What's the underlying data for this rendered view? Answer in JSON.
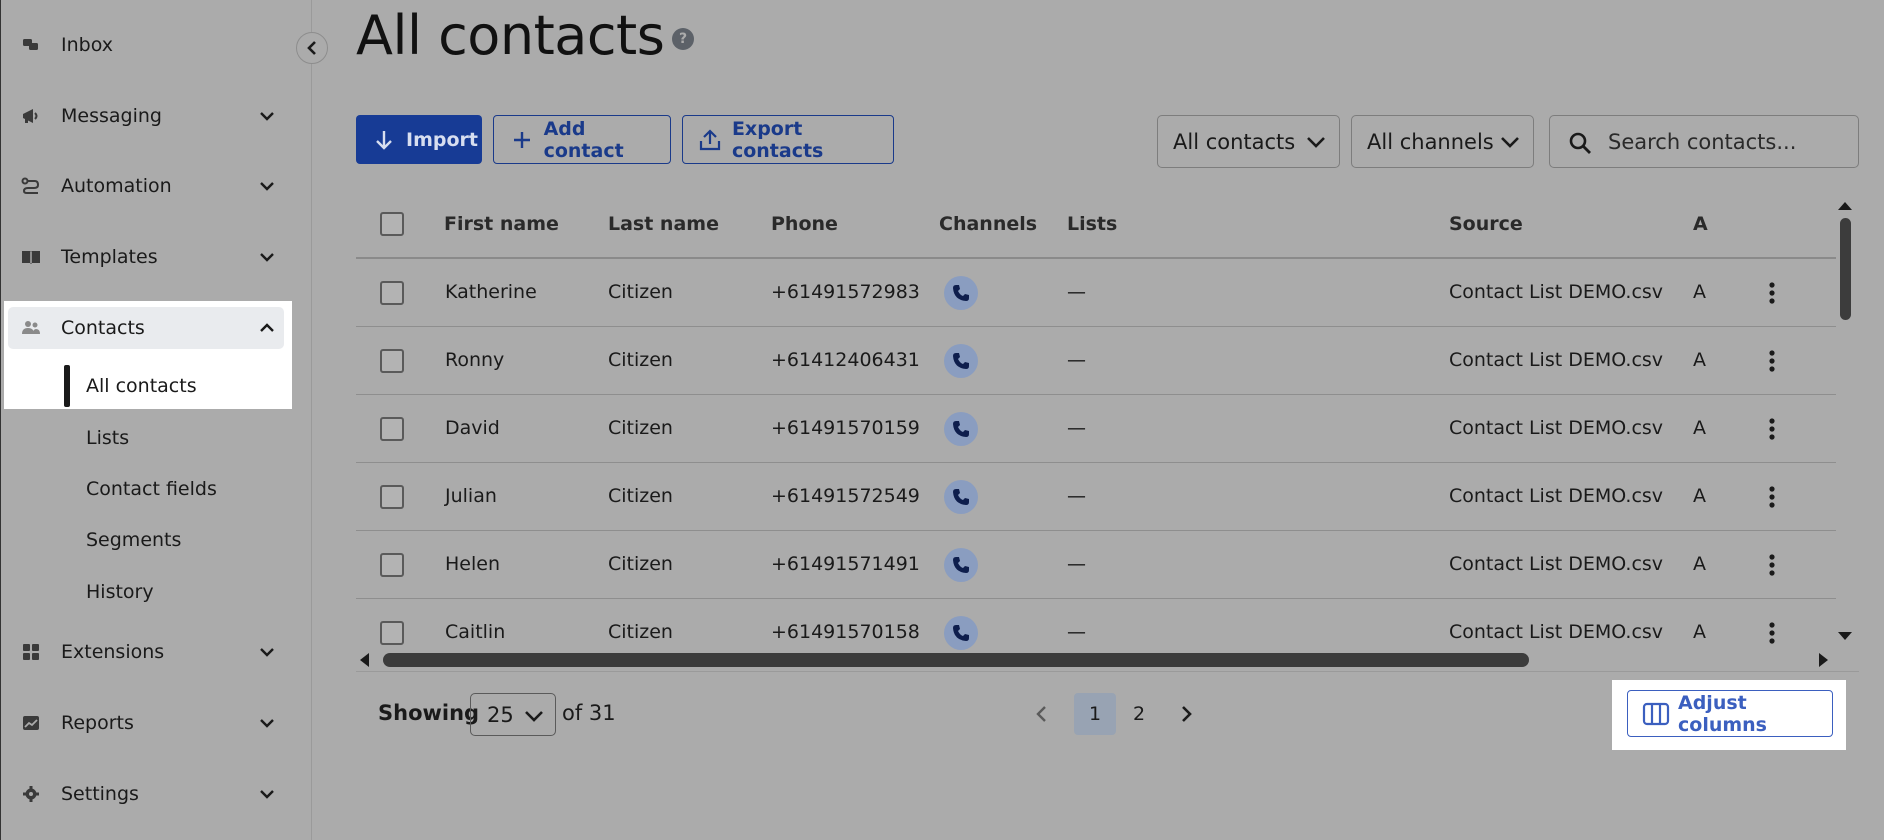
{
  "sidebar": {
    "items": [
      {
        "label": "Inbox",
        "icon": "chat-bubbles-icon"
      },
      {
        "label": "Messaging",
        "icon": "megaphone-icon"
      },
      {
        "label": "Automation",
        "icon": "route-icon"
      },
      {
        "label": "Templates",
        "icon": "book-icon"
      },
      {
        "label": "Contacts",
        "icon": "people-icon"
      },
      {
        "label": "Extensions",
        "icon": "grid-icon"
      },
      {
        "label": "Reports",
        "icon": "image-chart-icon"
      },
      {
        "label": "Settings",
        "icon": "gear-icon"
      }
    ],
    "contacts_sub": [
      "All contacts",
      "Lists",
      "Contact fields",
      "Segments",
      "History"
    ]
  },
  "header": {
    "title": "All contacts",
    "help": "?"
  },
  "toolbar": {
    "import_label": "Import",
    "add_contact_label": "Add contact",
    "export_label": "Export contacts",
    "filter_contacts": "All contacts",
    "filter_channels": "All channels",
    "search_placeholder": "Search contacts..."
  },
  "table": {
    "columns": [
      "First name",
      "Last name",
      "Phone",
      "Channels",
      "Lists",
      "Source",
      "A"
    ],
    "rows": [
      {
        "first": "Katherine",
        "last": "Citizen",
        "phone": "+61491572983",
        "lists": "—",
        "source": "Contact List DEMO.csv",
        "a": "A"
      },
      {
        "first": "Ronny",
        "last": "Citizen",
        "phone": "+61412406431",
        "lists": "—",
        "source": "Contact List DEMO.csv",
        "a": "A"
      },
      {
        "first": "David",
        "last": "Citizen",
        "phone": "+61491570159",
        "lists": "—",
        "source": "Contact List DEMO.csv",
        "a": "A"
      },
      {
        "first": "Julian",
        "last": "Citizen",
        "phone": "+61491572549",
        "lists": "—",
        "source": "Contact List DEMO.csv",
        "a": "A"
      },
      {
        "first": "Helen",
        "last": "Citizen",
        "phone": "+61491571491",
        "lists": "—",
        "source": "Contact List DEMO.csv",
        "a": "A"
      },
      {
        "first": "Caitlin",
        "last": "Citizen",
        "phone": "+61491570158",
        "lists": "—",
        "source": "Contact List DEMO.csv",
        "a": "A"
      }
    ]
  },
  "footer": {
    "showing_label": "Showing",
    "per_page": "25",
    "of_total": "of 31",
    "pages": [
      "1",
      "2"
    ],
    "current_page": "1",
    "adjust_columns_label": "Adjust columns"
  },
  "colors": {
    "primary": "#173b95",
    "outline": "#1a3a8a",
    "accent_blue": "#3b5fbf",
    "background": "#ababab"
  }
}
